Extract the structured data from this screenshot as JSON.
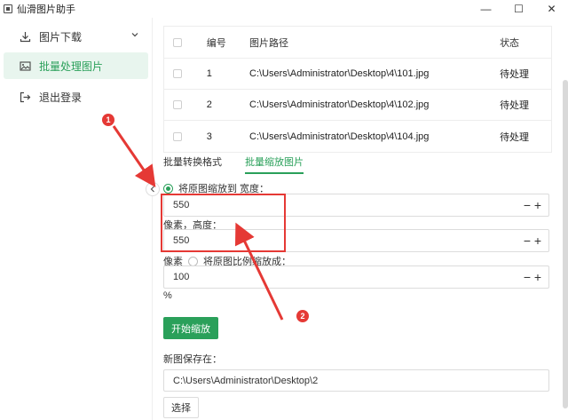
{
  "window": {
    "title": "仙滑图片助手",
    "controls": {
      "minimize": "—",
      "maximize": "☐",
      "close": "✕"
    }
  },
  "sidebar": {
    "items": [
      {
        "label": "图片下载",
        "icon": "download-icon",
        "has_chevron": true
      },
      {
        "label": "批量处理图片",
        "icon": "image-icon",
        "active": true
      },
      {
        "label": "退出登录",
        "icon": "logout-icon"
      }
    ]
  },
  "table": {
    "headers": {
      "no": "编号",
      "path": "图片路径",
      "status": "状态"
    },
    "rows": [
      {
        "no": "1",
        "path": "C:\\Users\\Administrator\\Desktop\\4\\101.jpg",
        "status": "待处理"
      },
      {
        "no": "2",
        "path": "C:\\Users\\Administrator\\Desktop\\4\\102.jpg",
        "status": "待处理"
      },
      {
        "no": "3",
        "path": "C:\\Users\\Administrator\\Desktop\\4\\104.jpg",
        "status": "待处理"
      }
    ]
  },
  "tabs": [
    {
      "label": "批量转换格式",
      "active": false
    },
    {
      "label": "批量缩放图片",
      "active": true
    }
  ],
  "resize": {
    "option_scale_to": "将原图缩放到 宽度：",
    "width_value": "550",
    "height_label": "像素，高度：",
    "height_value": "550",
    "pixel_unit": "像素",
    "option_ratio": "将原图比例缩放成：",
    "ratio_value": "100",
    "percent_unit": "%",
    "start_button": "开始缩放"
  },
  "save": {
    "label": "新图保存在：",
    "path": "C:\\Users\\Administrator\\Desktop\\2",
    "choose_button": "选择"
  },
  "annotations": [
    {
      "label": "1"
    },
    {
      "label": "2"
    }
  ],
  "colors": {
    "accent": "#2aa05a",
    "accent_bg": "#e8f5ee",
    "annotation": "#e53935"
  }
}
